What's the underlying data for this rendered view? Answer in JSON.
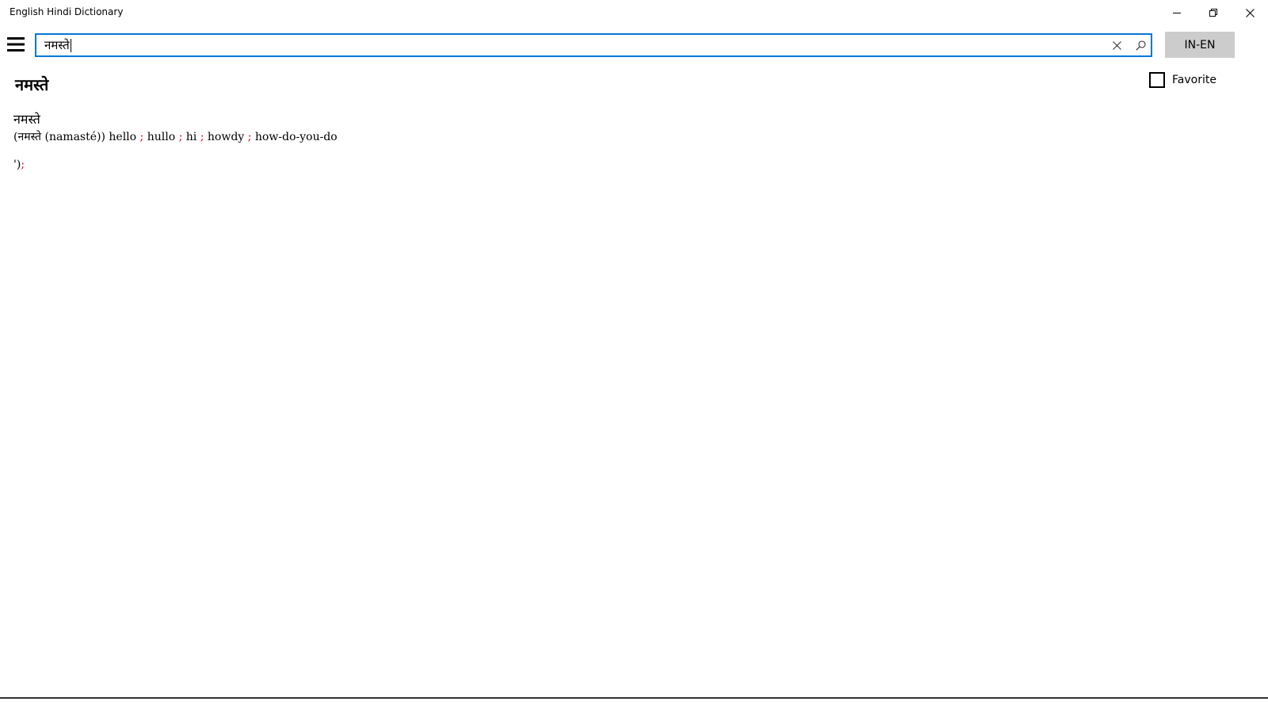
{
  "window": {
    "title": "English Hindi Dictionary",
    "controls": [
      "minimize",
      "restore",
      "close"
    ]
  },
  "toolbar": {
    "menu_icon": "hamburger-icon",
    "search": {
      "value": "नमस्ते",
      "clear_icon": "close-icon",
      "search_icon": "search-icon"
    },
    "language_button": "IN-EN"
  },
  "entry": {
    "headword": "नमस्ते",
    "favorite_label": "Favorite",
    "favorite_checked": false,
    "word": "नमस्ते",
    "definition": {
      "prefix": "(नमस्ते (namasté))",
      "meanings": [
        "hello",
        "hullo",
        "hi",
        "howdy",
        "how-do-you-do"
      ],
      "separator": ";"
    },
    "stray_text": "')",
    "stray_semicolon": ";"
  },
  "colors": {
    "accent": "#0078d7",
    "separator": "#e00000",
    "button_bg": "#cccccc"
  }
}
